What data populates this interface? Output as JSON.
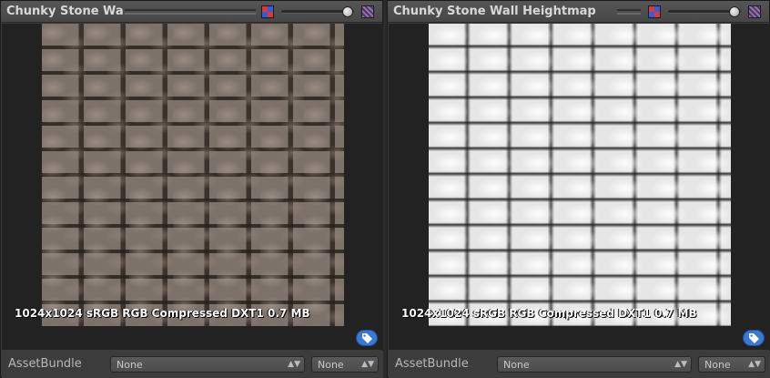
{
  "panels": [
    {
      "title": "Chunky Stone Wall",
      "texture_info": "1024x1024 sRGB  RGB Compressed DXT1   0.7 MB",
      "bundle_label": "AssetBundle",
      "bundle_name": "None",
      "bundle_variant": "None",
      "preview": "stone-color-texture"
    },
    {
      "title": "Chunky Stone Wall Heightmap",
      "texture_info": "1024x1024 sRGB  RGB Compressed DXT1   0.7 MB",
      "bundle_label": "AssetBundle",
      "bundle_name": "None",
      "bundle_variant": "None",
      "preview": "stone-heightmap-texture"
    }
  ],
  "icons": {
    "rgb_toggle": "rgb-channel-icon",
    "alpha_toggle": "alpha-channel-icon",
    "mip_slider": "mip-level-slider",
    "label_button": "tag-icon"
  },
  "colors": {
    "panel_bg": "#3c3c3c",
    "accent": "#3a78d2"
  }
}
